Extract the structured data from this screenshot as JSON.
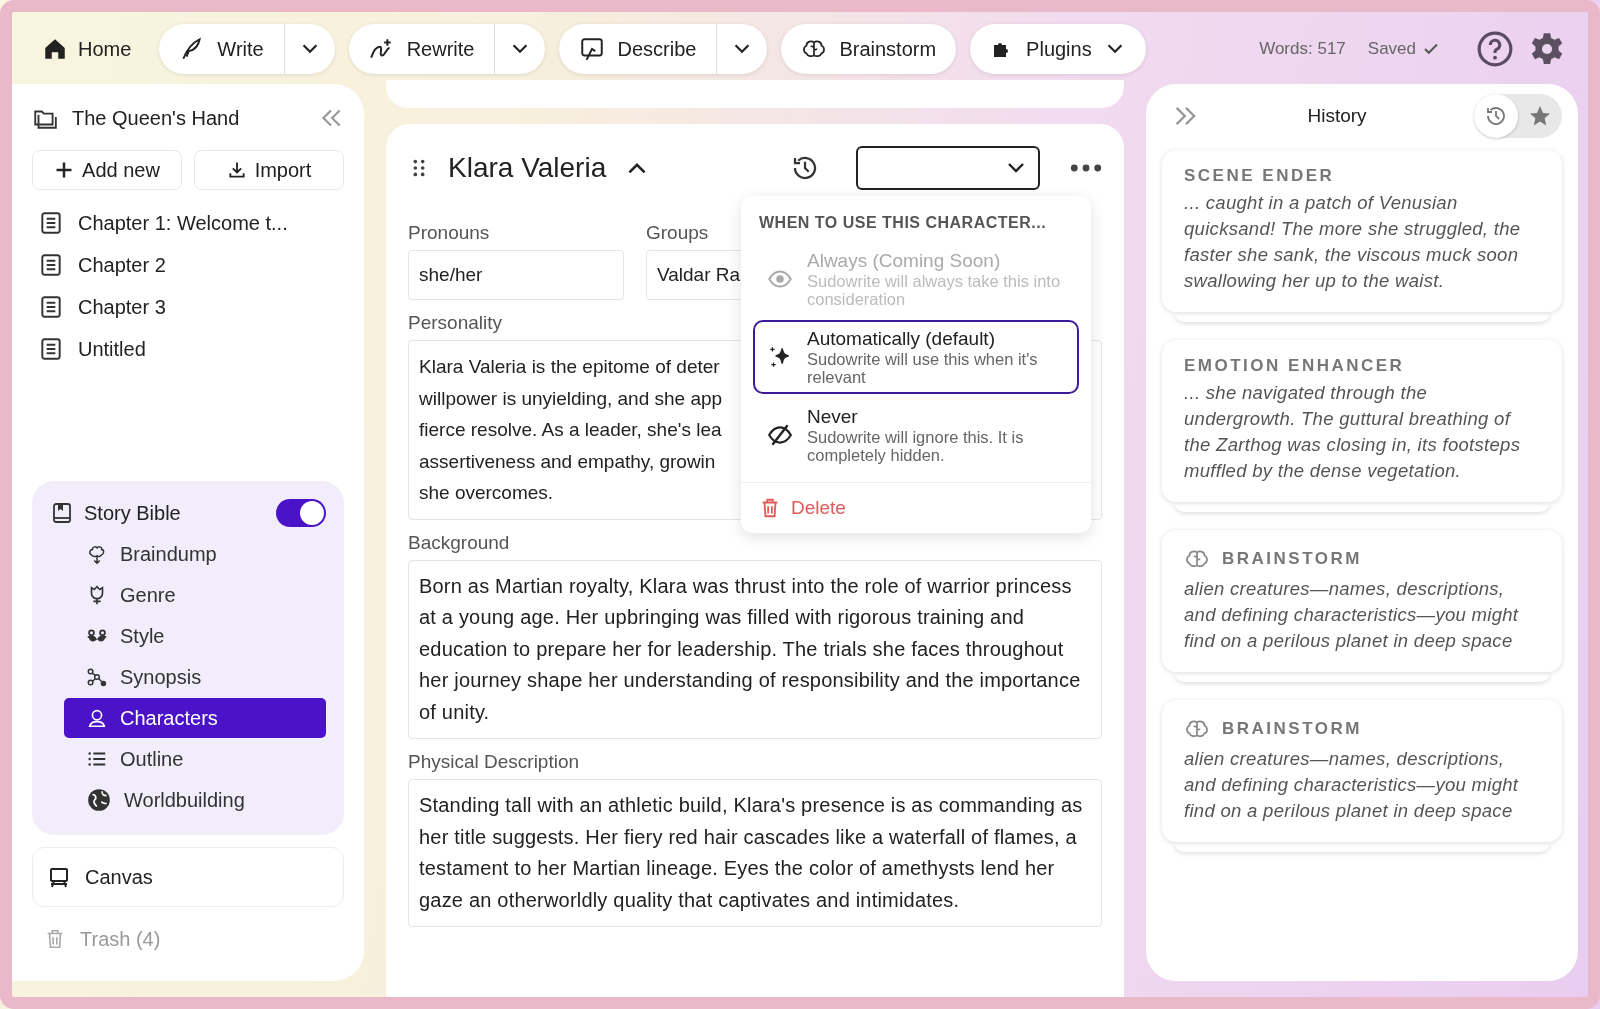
{
  "toolbar": {
    "home": "Home",
    "tools": [
      {
        "kind": "split",
        "label": "Write"
      },
      {
        "kind": "split",
        "label": "Rewrite"
      },
      {
        "kind": "split",
        "label": "Describe"
      },
      {
        "kind": "plain",
        "label": "Brainstorm"
      },
      {
        "kind": "menu",
        "label": "Plugins"
      }
    ],
    "words": "Words: 517",
    "saved": "Saved"
  },
  "sidebar": {
    "project": "The Queen's Hand",
    "add": "Add new",
    "import": "Import",
    "chapters": [
      "Chapter 1: Welcome t...",
      "Chapter 2",
      "Chapter 3",
      "Untitled"
    ],
    "story_bible": {
      "label": "Story Bible",
      "on": true,
      "items": [
        {
          "label": "Braindump",
          "selected": false
        },
        {
          "label": "Genre",
          "selected": false
        },
        {
          "label": "Style",
          "selected": false
        },
        {
          "label": "Synopsis",
          "selected": false
        },
        {
          "label": "Characters",
          "selected": true
        },
        {
          "label": "Outline",
          "selected": false
        },
        {
          "label": "Worldbuilding",
          "selected": false
        }
      ]
    },
    "canvas": "Canvas",
    "trash": "Trash (4)"
  },
  "character": {
    "name": "Klara Valeria",
    "pronouns": {
      "label": "Pronouns",
      "value": "she/her"
    },
    "groups": {
      "label": "Groups",
      "value": "Valdar Ra"
    },
    "personality": {
      "label": "Personality",
      "lines": [
        "Klara Valeria is the epitome of deter",
        "willpower is unyielding, and she app",
        "fierce resolve. As a leader, she's lea",
        "assertiveness and empathy, growin",
        "she overcomes."
      ]
    },
    "background": {
      "label": "Background",
      "value": "Born as Martian royalty, Klara was thrust into the role of warrior princess at a young age. Her upbringing was filled with rigorous training and education to prepare her for leadership. The trials she faces throughout her journey shape her understanding of responsibility and the importance of unity."
    },
    "physical": {
      "label": "Physical Description",
      "value": "Standing tall with an athletic build, Klara's presence is as commanding as her title suggests. Her fiery red hair cascades like a waterfall of flames, a testament to her Martian lineage. Eyes the color of amethysts lend her gaze an otherworldly quality that captivates and intimidates."
    }
  },
  "usage_menu": {
    "heading": "WHEN TO USE THIS CHARACTER...",
    "options": [
      {
        "title": "Always (Coming Soon)",
        "description": "Sudowrite will always take this into consideration",
        "disabled": true,
        "selected": false
      },
      {
        "title": "Automatically (default)",
        "description": "Sudowrite will use this when it's relevant",
        "disabled": false,
        "selected": true
      },
      {
        "title": "Never",
        "description": "Sudowrite will ignore this. It is completely hidden.",
        "disabled": false,
        "selected": false
      }
    ],
    "delete": "Delete"
  },
  "history": {
    "title": "History",
    "views": [
      {
        "kind": "history",
        "selected": true
      },
      {
        "kind": "starred",
        "selected": false
      }
    ],
    "cards": [
      {
        "kind": "plain",
        "title": "SCENE ENDER",
        "text": "... caught in a patch of Venusian quicksand! The more she struggled, the faster she sank, the viscous muck soon swallowing her up to the waist."
      },
      {
        "kind": "plain",
        "title": "EMOTION ENHANCER",
        "text": "... she navigated through the undergrowth. The guttural breathing of the Zarthog was closing in, its footsteps muffled by the dense vegetation."
      },
      {
        "kind": "brainstorm",
        "title": "BRAINSTORM",
        "text": "alien creatures—names, descriptions, and defining characteristics—you might find on a perilous planet in deep space"
      },
      {
        "kind": "brainstorm",
        "title": "BRAINSTORM",
        "text": "alien creatures—names, descriptions, and defining characteristics—you might find on a perilous planet in deep space"
      }
    ]
  }
}
